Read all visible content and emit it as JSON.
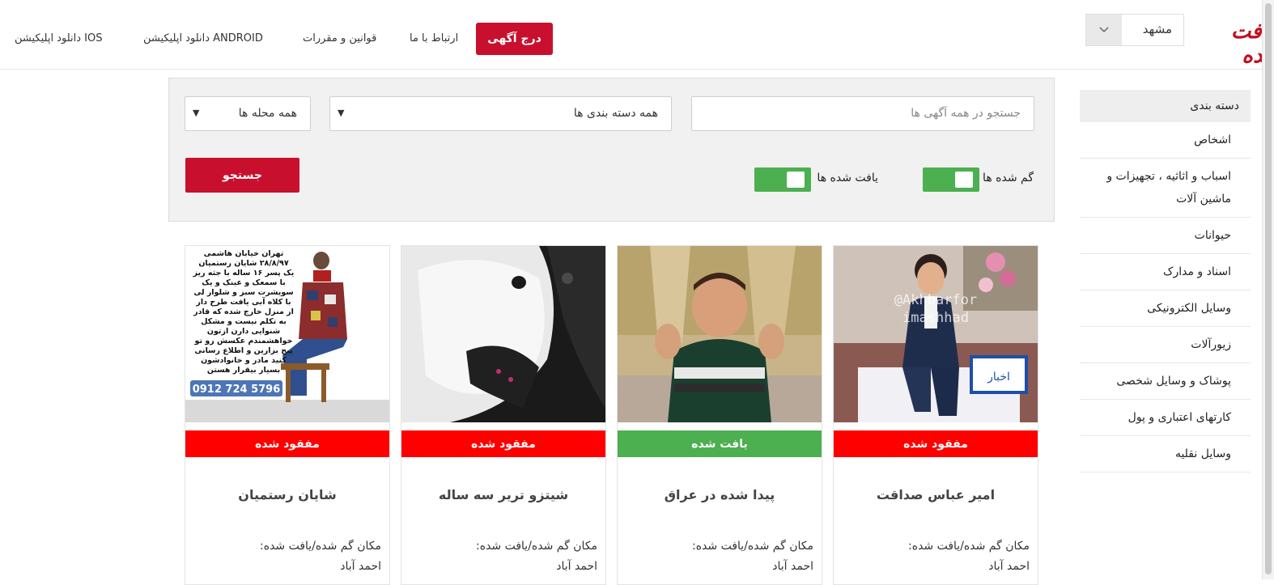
{
  "header": {
    "logo": "یافت کده",
    "city": "مشهد",
    "post_ad": "درج آگهی",
    "nav": {
      "contact": "ارتباط با ما",
      "rules": "قوانین و مقررات",
      "android": "دانلود اپلیکیشن ANDROID",
      "ios": "دانلود اپلیکیشن IOS"
    }
  },
  "sidebar": {
    "title": "دسته بندی",
    "items": [
      "اشخاص",
      "اسباب و اثاثیه ، تجهیزات و ماشین آلات",
      "حیوانات",
      "اسناد و مدارک",
      "وسایل الکترونیکی",
      "زیورآلات",
      "پوشاک و وسایل شخصی",
      "کارتهای اعتباری و پول",
      "وسایل نقلیه"
    ]
  },
  "search": {
    "placeholder": "جستجو در همه آگهی ها",
    "category": "همه دسته بندی ها",
    "district": "همه محله ها",
    "lost_toggle": "گم شده ها",
    "found_toggle": "یافت شده ها",
    "button": "جستجو"
  },
  "cards": [
    {
      "status": "مفقود شده",
      "title": "امیر عباس صداقت",
      "loc_label": "مکان گم شده/یافت شده:",
      "loc_value": "احمد آباد",
      "watermark1": "@Akhbarfor",
      "watermark2": "imashhad",
      "stamp": "اخبار"
    },
    {
      "status": "یافت شده",
      "title": "پیدا شده در عراق",
      "loc_label": "مکان گم شده/یافت شده:",
      "loc_value": "احمد آباد"
    },
    {
      "status": "مفقود شده",
      "title": "شیتزو تریر سه ساله",
      "loc_label": "مکان گم شده/یافت شده:",
      "loc_value": "احمد آباد"
    },
    {
      "status": "مفقود شده",
      "title": "شایان رستمیان",
      "loc_label": "مکان گم شده/یافت شده:",
      "loc_value": "احمد آباد",
      "phone": "0912 724 5796",
      "photo_text": [
        "تهران خیابان هاشمی",
        "۲۸/۸/۹۷ شایان رستمیان",
        "یک پسر ۱۶ ساله با جثه ریز",
        "با سمعک و عینک و یک",
        "سویشرت سبز و شلوار لی",
        "با کلاه آبی یافت طرح دار",
        "از منزل خارج شده که قادر",
        "به تکلم نیست و مشکل",
        "شنوایی دارن ازتون",
        "خواهشمندم عکسش رو تو",
        "پیج بزارین و اطلاع رسانی",
        "کنید مادر و خانوادشون",
        "بسیار بیقرار هستن"
      ]
    }
  ],
  "colors": {
    "brand_red": "#c8102e",
    "lost_red": "#ff0000",
    "found_green": "#4caf50"
  }
}
